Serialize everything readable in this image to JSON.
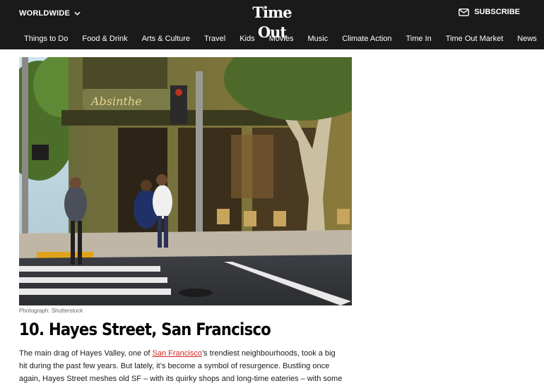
{
  "header": {
    "edition_label": "WORLDWIDE",
    "logo_text": "Time Out",
    "subscribe_label": "SUBSCRIBE"
  },
  "nav": {
    "items": [
      "Things to Do",
      "Food & Drink",
      "Arts & Culture",
      "Travel",
      "Kids",
      "Movies",
      "Music",
      "Climate Action",
      "Time In",
      "Time Out Market",
      "News"
    ]
  },
  "article": {
    "photo_credit": "Photograph: Shutterstock",
    "heading": "10. Hayes Street, San Francisco",
    "body_before_link": "The main drag of Hayes Valley, one of ",
    "body_link": "San Francisco",
    "body_after_link": "’s trendiest neighbourhoods, took a big hit during the past few years. But lately, it’s become a symbol of resurgence. Bustling once again, Hayes Street meshes old SF – with its quirky shops and long-time eateries – with some of the city’s most exciting new restaurants, cocktail bars and design-led stores."
  }
}
